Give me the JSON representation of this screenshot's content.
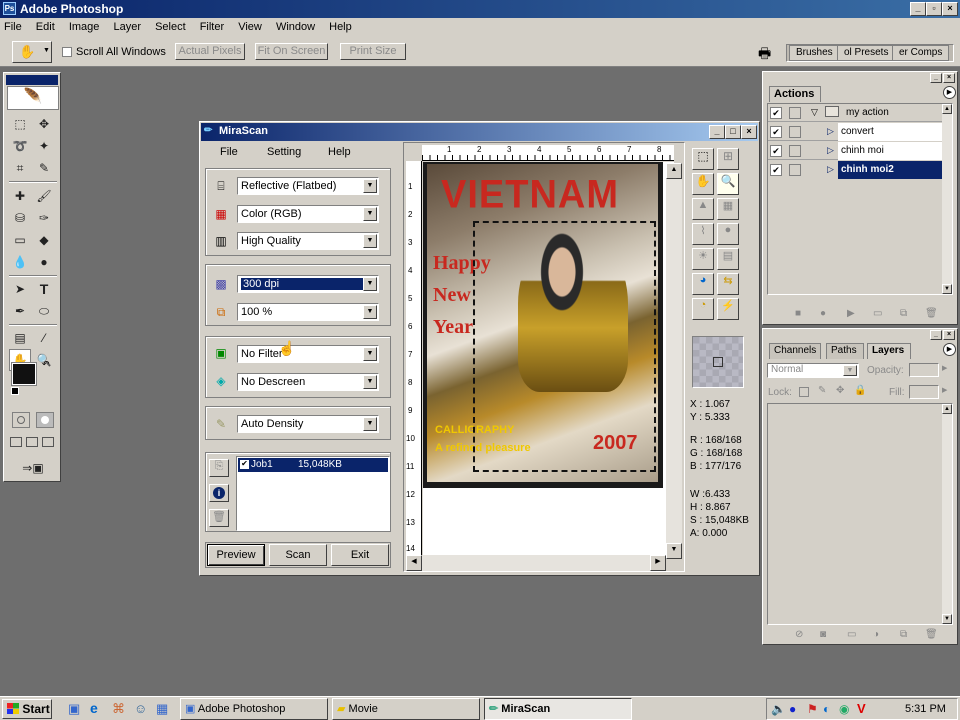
{
  "photoshop": {
    "title": "Adobe Photoshop",
    "menu": [
      "File",
      "Edit",
      "Image",
      "Layer",
      "Select",
      "Filter",
      "View",
      "Window",
      "Help"
    ],
    "options": {
      "scroll_all": "Scroll All Windows",
      "actual_pixels": "Actual Pixels",
      "fit_on_screen": "Fit On Screen",
      "print_size": "Print Size"
    },
    "well_tabs": [
      "Brushes",
      "ol Presets",
      "er Comps"
    ],
    "actions": {
      "title": "Actions",
      "items": [
        {
          "label": "my action"
        },
        {
          "label": "convert"
        },
        {
          "label": "chinh moi"
        },
        {
          "label": "chinh moi2"
        }
      ]
    },
    "layers": {
      "tabs": [
        "Channels",
        "Paths",
        "Layers"
      ],
      "blend_mode": "Normal",
      "opacity_label": "Opacity:",
      "lock_label": "Lock:",
      "fill_label": "Fill:"
    }
  },
  "mirascan": {
    "title": "MiraScan",
    "menu": [
      "File",
      "Setting",
      "Help"
    ],
    "scan_type": "Reflective (Flatbed)",
    "color_mode": "Color (RGB)",
    "quality": "High Quality",
    "resolution": "300 dpi",
    "scale": "100 %",
    "filter": "No Filter",
    "descreen": "No Descreen",
    "density": "Auto Density",
    "job": {
      "name": "Job1",
      "size": "15,048KB"
    },
    "buttons": {
      "preview": "Preview",
      "scan": "Scan",
      "exit": "Exit"
    },
    "ruler_top": [
      "1",
      "2",
      "3",
      "4",
      "5",
      "6",
      "7",
      "8"
    ],
    "ruler_left": [
      "1",
      "2",
      "3",
      "4",
      "5",
      "6",
      "7",
      "8",
      "9",
      "10",
      "11",
      "12",
      "13",
      "14"
    ],
    "readout": {
      "x": "X : 1.067",
      "y": "Y : 5.333",
      "r": "R : 168/168",
      "g": "G : 168/168",
      "b": "B : 177/176",
      "w": "W :6.433",
      "h": "H : 8.867",
      "s": "S : 15,048KB",
      "a": "A: 0.000"
    },
    "image": {
      "title": "VIETNAM",
      "greeting": [
        "Happy",
        "New",
        "Year"
      ],
      "caption1": "CALLIGRAPHY",
      "caption2": "A refined pleasure",
      "year": "2007"
    }
  },
  "taskbar": {
    "start": "Start",
    "tasks": [
      "Adobe Photoshop",
      "Movie",
      "MiraScan"
    ],
    "clock": "5:31 PM"
  }
}
